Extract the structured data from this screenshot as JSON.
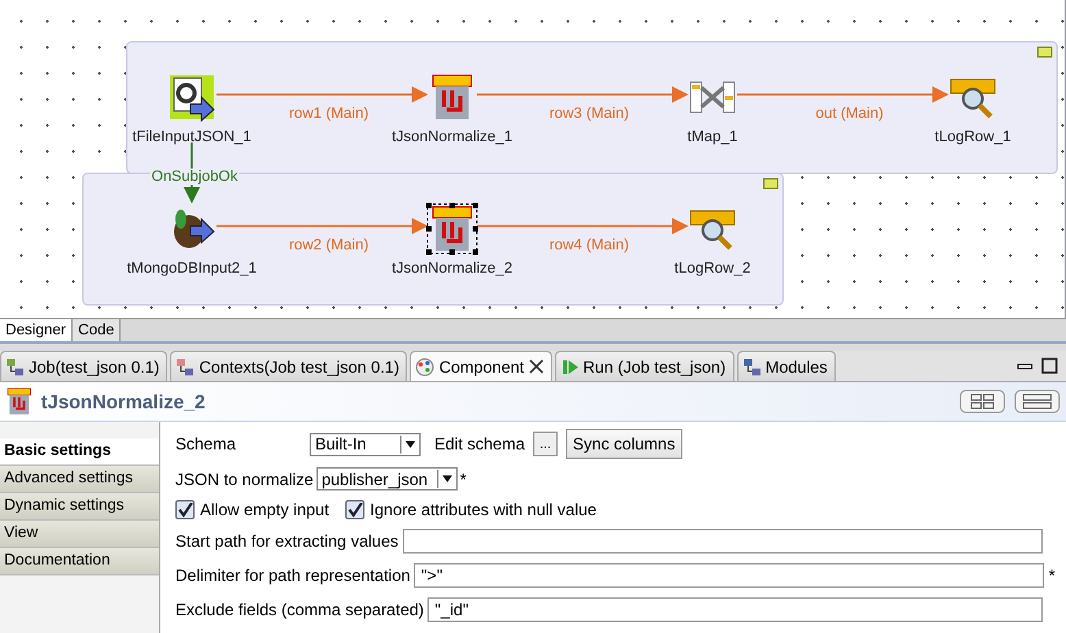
{
  "subjobs": [
    {
      "nodes": [
        {
          "kind": "file-input",
          "label": "tFileInputJSON_1",
          "selected": false
        },
        {
          "kind": "json-normalize",
          "label": "tJsonNormalize_1",
          "selected": false
        },
        {
          "kind": "map",
          "label": "tMap_1",
          "selected": false
        },
        {
          "kind": "log-row",
          "label": "tLogRow_1",
          "selected": false
        }
      ],
      "links": [
        "row1 (Main)",
        "row3 (Main)",
        "out (Main)"
      ]
    },
    {
      "nodes": [
        {
          "kind": "mongo-input",
          "label": "tMongoDBInput2_1",
          "selected": false
        },
        {
          "kind": "json-normalize",
          "label": "tJsonNormalize_2",
          "selected": true
        },
        {
          "kind": "log-row",
          "label": "tLogRow_2",
          "selected": false
        }
      ],
      "links": [
        "row2 (Main)",
        "row4 (Main)"
      ]
    }
  ],
  "trigger": "OnSubjobOk",
  "editor_tabs": [
    {
      "label": "Designer",
      "selected": true
    },
    {
      "label": "Code",
      "selected": false
    }
  ],
  "panel_tabs": [
    {
      "kind": "job",
      "label": "Job(test_json 0.1)",
      "selected": false,
      "closable": false
    },
    {
      "kind": "contexts",
      "label": "Contexts(Job test_json 0.1)",
      "selected": false,
      "closable": false
    },
    {
      "kind": "component",
      "label": "Component",
      "selected": true,
      "closable": true
    },
    {
      "kind": "run",
      "label": "Run (Job test_json)",
      "selected": false,
      "closable": false
    },
    {
      "kind": "modules",
      "label": "Modules",
      "selected": false,
      "closable": false
    }
  ],
  "component_title": "tJsonNormalize_2",
  "side_tabs": [
    {
      "label": "Basic settings",
      "selected": true
    },
    {
      "label": "Advanced settings",
      "selected": false
    },
    {
      "label": "Dynamic settings",
      "selected": false
    },
    {
      "label": "View",
      "selected": false
    },
    {
      "label": "Documentation",
      "selected": false
    }
  ],
  "schema": {
    "label": "Schema",
    "value": "Built-In",
    "edit_label": "Edit schema",
    "ellipsis": "...",
    "sync": "Sync columns"
  },
  "json_to_normalize": {
    "label": "JSON to normalize",
    "value": "publisher_json",
    "required": "*"
  },
  "checkboxes": [
    {
      "label": "Allow empty input",
      "checked": true
    },
    {
      "label": "Ignore attributes with null value",
      "checked": true
    }
  ],
  "text_fields": [
    {
      "label": "Start path for extracting values"
    },
    {
      "label": "Delimiter for path representation",
      "value": "\">\"",
      "required": "*"
    },
    {
      "label": "Exclude fields (comma separated)",
      "value": "\"_id\""
    }
  ]
}
